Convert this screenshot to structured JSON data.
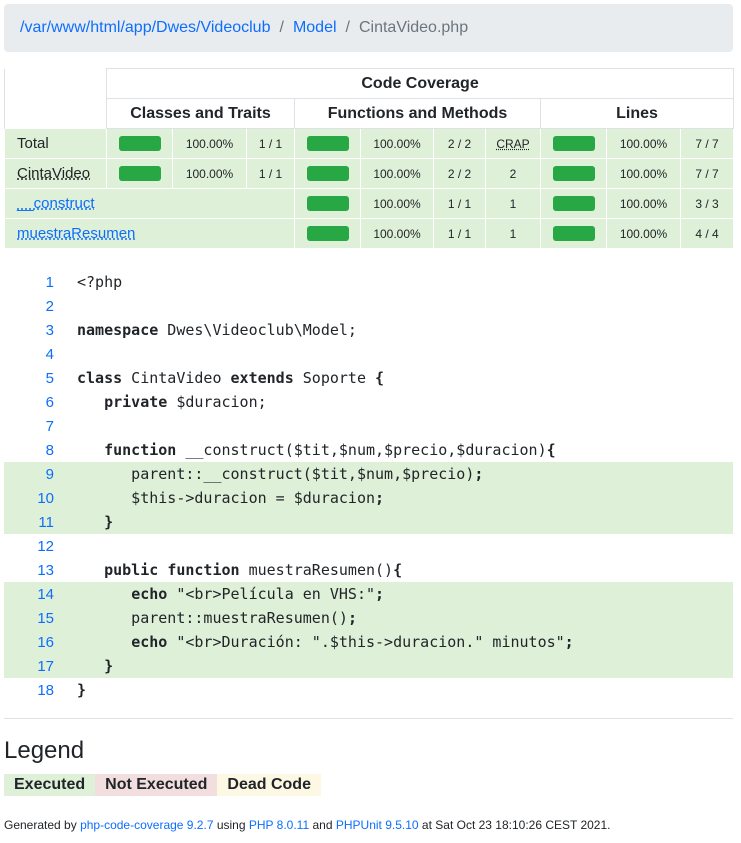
{
  "breadcrumb": {
    "path": "/var/www/html/app/Dwes/Videoclub",
    "model": "Model",
    "file": "CintaVideo.php",
    "separator": "/"
  },
  "coverage": {
    "title": "Code Coverage",
    "headers": [
      "Classes and Traits",
      "Functions and Methods",
      "Lines"
    ],
    "rows": [
      {
        "name": "Total",
        "cls_pct": "100.00%",
        "cls_count": "1 / 1",
        "fn_pct": "100.00%",
        "fn_count": "2 / 2",
        "crap": "CRAP",
        "ln_pct": "100.00%",
        "ln_count": "7 / 7"
      },
      {
        "name": "CintaVideo",
        "cls_pct": "100.00%",
        "cls_count": "1 / 1",
        "fn_pct": "100.00%",
        "fn_count": "2 / 2",
        "crap": "2",
        "ln_pct": "100.00%",
        "ln_count": "7 / 7"
      },
      {
        "name": "__construct",
        "fn_pct": "100.00%",
        "fn_count": "1 / 1",
        "crap": "1",
        "ln_pct": "100.00%",
        "ln_count": "3 / 3"
      },
      {
        "name": "muestraResumen",
        "fn_pct": "100.00%",
        "fn_count": "1 / 1",
        "crap": "1",
        "ln_pct": "100.00%",
        "ln_count": "4 / 4"
      }
    ]
  },
  "code": {
    "lines": [
      {
        "n": "1",
        "covered": false,
        "html": "&lt;?php"
      },
      {
        "n": "2",
        "covered": false,
        "html": ""
      },
      {
        "n": "3",
        "covered": false,
        "html": "<b class='kw'>namespace</b> Dwes\\Videoclub\\Model;"
      },
      {
        "n": "4",
        "covered": false,
        "html": ""
      },
      {
        "n": "5",
        "covered": false,
        "html": "<b class='kw'>class</b> CintaVideo <b class='kw'>extends</b> Soporte <b class='kw'>{</b>"
      },
      {
        "n": "6",
        "covered": false,
        "html": "   <b class='kw'>private</b> $duracion;"
      },
      {
        "n": "7",
        "covered": false,
        "html": ""
      },
      {
        "n": "8",
        "covered": false,
        "html": "   <b class='kw'>function</b> __construct($tit,$num,$precio,$duracion)<b class='kw'>{</b>"
      },
      {
        "n": "9",
        "covered": true,
        "html": "      parent::__construct($tit,$num,$precio)<b class='kw'>;</b>"
      },
      {
        "n": "10",
        "covered": true,
        "html": "      $this-&gt;duracion = $duracion<b class='kw'>;</b>"
      },
      {
        "n": "11",
        "covered": true,
        "html": "   <b class='kw'>}</b>"
      },
      {
        "n": "12",
        "covered": false,
        "html": ""
      },
      {
        "n": "13",
        "covered": false,
        "html": "   <b class='kw'>public</b> <b class='kw'>function</b> muestraResumen()<b class='kw'>{</b>"
      },
      {
        "n": "14",
        "covered": true,
        "html": "      <b class='kw'>echo</b> \"&lt;br&gt;Película en VHS:\"<b class='kw'>;</b>"
      },
      {
        "n": "15",
        "covered": true,
        "html": "      parent::muestraResumen()<b class='kw'>;</b>"
      },
      {
        "n": "16",
        "covered": true,
        "html": "      <b class='kw'>echo</b> \"&lt;br&gt;Duración: \".$this-&gt;duracion.\" minutos\"<b class='kw'>;</b>"
      },
      {
        "n": "17",
        "covered": true,
        "html": "   <b class='kw'>}</b>"
      },
      {
        "n": "18",
        "covered": false,
        "html": "<b class='kw'>}</b>"
      }
    ]
  },
  "legend": {
    "title": "Legend",
    "executed": "Executed",
    "not_executed": "Not Executed",
    "dead_code": "Dead Code"
  },
  "footer": {
    "prefix": "Generated by",
    "tool": "php-code-coverage 9.2.7",
    "using": "using",
    "php": "PHP 8.0.11",
    "and": "and",
    "phpunit": "PHPUnit 9.5.10",
    "suffix": "at Sat Oct 23 18:10:26 CEST 2021."
  },
  "colors": {
    "covered": "#dff0d8",
    "bar": "#28a745",
    "link": "#0d6efd",
    "not_executed": "#f2dede",
    "dead_code": "#fcf8e3"
  }
}
